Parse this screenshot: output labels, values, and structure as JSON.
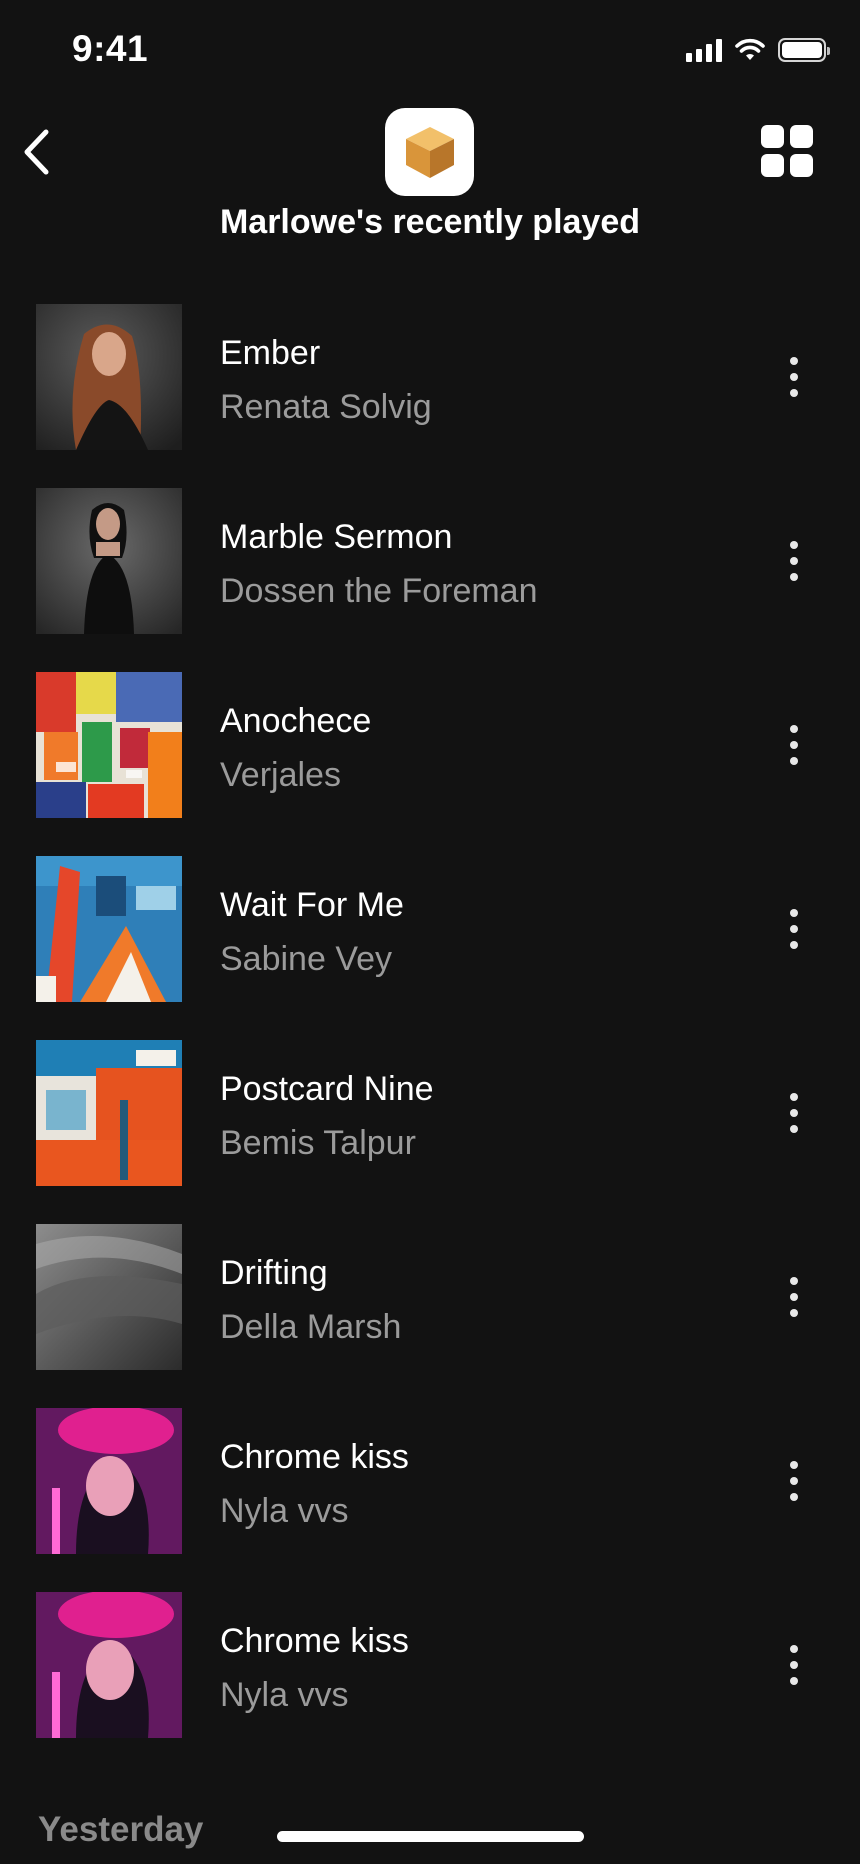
{
  "status_bar": {
    "time": "9:41",
    "icons": [
      "signal-icon",
      "wifi-icon",
      "battery-icon"
    ]
  },
  "header": {
    "back_icon": "chevron-left-icon",
    "logo_icon": "box-icon",
    "view_icon": "grid-icon",
    "title": "Marlowe's recently played"
  },
  "colors": {
    "background": "#121212",
    "primary_text": "#ffffff",
    "secondary_text": "#9b9b9b",
    "logo_box": "#e0a245"
  },
  "tracks": [
    {
      "title": "Ember",
      "artist": "Renata Solvig",
      "cover": "portrait-red-hair"
    },
    {
      "title": "Marble Sermon",
      "artist": "Dossen the Foreman",
      "cover": "portrait-black-dress"
    },
    {
      "title": "Anochece",
      "artist": "Verjales",
      "cover": "abstract-multicolor"
    },
    {
      "title": "Wait For Me",
      "artist": "Sabine Vey",
      "cover": "abstract-blue-orange"
    },
    {
      "title": "Postcard Nine",
      "artist": "Bemis Talpur",
      "cover": "abstract-orange-teal"
    },
    {
      "title": "Drifting",
      "artist": "Della Marsh",
      "cover": "grey-dunes"
    },
    {
      "title": "Chrome kiss",
      "artist": "Nyla vvs",
      "cover": "neon-portrait"
    },
    {
      "title": "Chrome kiss",
      "artist": "Nyla vvs",
      "cover": "neon-portrait"
    }
  ],
  "sections": {
    "yesterday": "Yesterday"
  }
}
